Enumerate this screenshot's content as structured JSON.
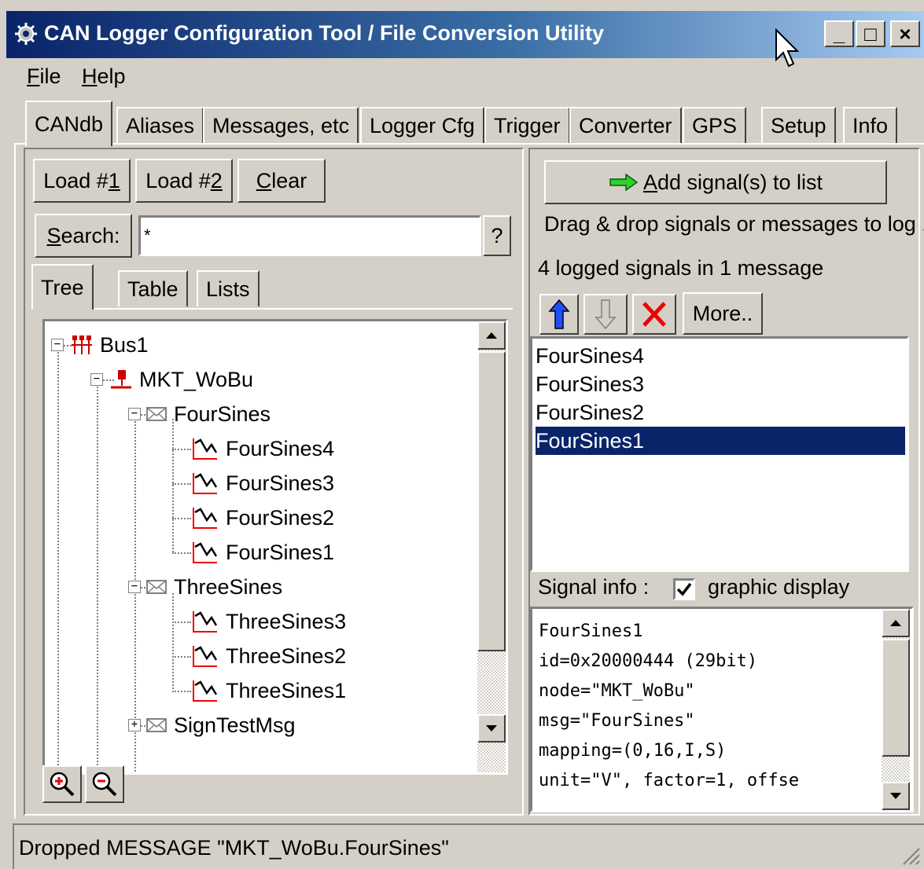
{
  "window": {
    "title": "CAN Logger Configuration Tool / File Conversion Utility",
    "controls": [
      "_",
      "□",
      "×"
    ]
  },
  "menu": [
    {
      "label": "File",
      "accel": "F",
      "rest": "ile"
    },
    {
      "label": "Help",
      "accel": "H",
      "rest": "elp"
    }
  ],
  "tabs": [
    "CANdb",
    "Aliases",
    "Messages, etc",
    "Logger Cfg",
    "Trigger",
    "Converter",
    "GPS",
    "Setup",
    "Info"
  ],
  "active_tab": "CANdb",
  "left": {
    "load1": {
      "pre": "Load #",
      "accel": "1"
    },
    "load2": {
      "pre": "Load #",
      "accel": "2"
    },
    "clear": {
      "accel": "C",
      "rest": "lear"
    },
    "search_label": {
      "accel": "S",
      "rest": "earch:"
    },
    "search_value": "*",
    "help_button": "?",
    "subtabs": [
      "Tree",
      "Table",
      "Lists"
    ],
    "tree": [
      {
        "label": "Bus1",
        "icon": "bus-icon"
      },
      {
        "label": "MKT_WoBu",
        "icon": "node-icon"
      },
      {
        "label": "FourSines",
        "icon": "message-icon"
      },
      {
        "label": "FourSines4",
        "icon": "signal-icon"
      },
      {
        "label": "FourSines3",
        "icon": "signal-icon"
      },
      {
        "label": "FourSines2",
        "icon": "signal-icon"
      },
      {
        "label": "FourSines1",
        "icon": "signal-icon"
      },
      {
        "label": "ThreeSines",
        "icon": "message-icon"
      },
      {
        "label": "ThreeSines3",
        "icon": "signal-icon"
      },
      {
        "label": "ThreeSines2",
        "icon": "signal-icon"
      },
      {
        "label": "ThreeSines1",
        "icon": "signal-icon"
      },
      {
        "label": "SignTestMsg",
        "icon": "message-icon"
      }
    ]
  },
  "right": {
    "add_button": {
      "accel": "A",
      "rest": "dd signal(s) to list"
    },
    "hint": "Drag & drop signals or messages to log .",
    "count": "4 logged signals in 1 message",
    "more_button": "More..",
    "signals": [
      "FourSines4",
      "FourSines3",
      "FourSines2",
      "FourSines1"
    ],
    "selected_signal": "FourSines1",
    "signal_info_label": "Signal info :",
    "graphic_display_label": "graphic display",
    "graphic_display_checked": true,
    "info_lines": [
      "FourSines1",
      "id=0x20000444 (29bit)",
      "node=\"MKT_WoBu\"",
      "msg=\"FourSines\"",
      "mapping=(0,16,I,S)",
      "unit=\"V\", factor=1, offse"
    ]
  },
  "status": "Dropped MESSAGE \"MKT_WoBu.FourSines\"",
  "colors": {
    "titlebar_start": "#0a246a",
    "titlebar_end": "#a6caf0",
    "selection": "#0a246a",
    "face": "#d4d0c8"
  }
}
